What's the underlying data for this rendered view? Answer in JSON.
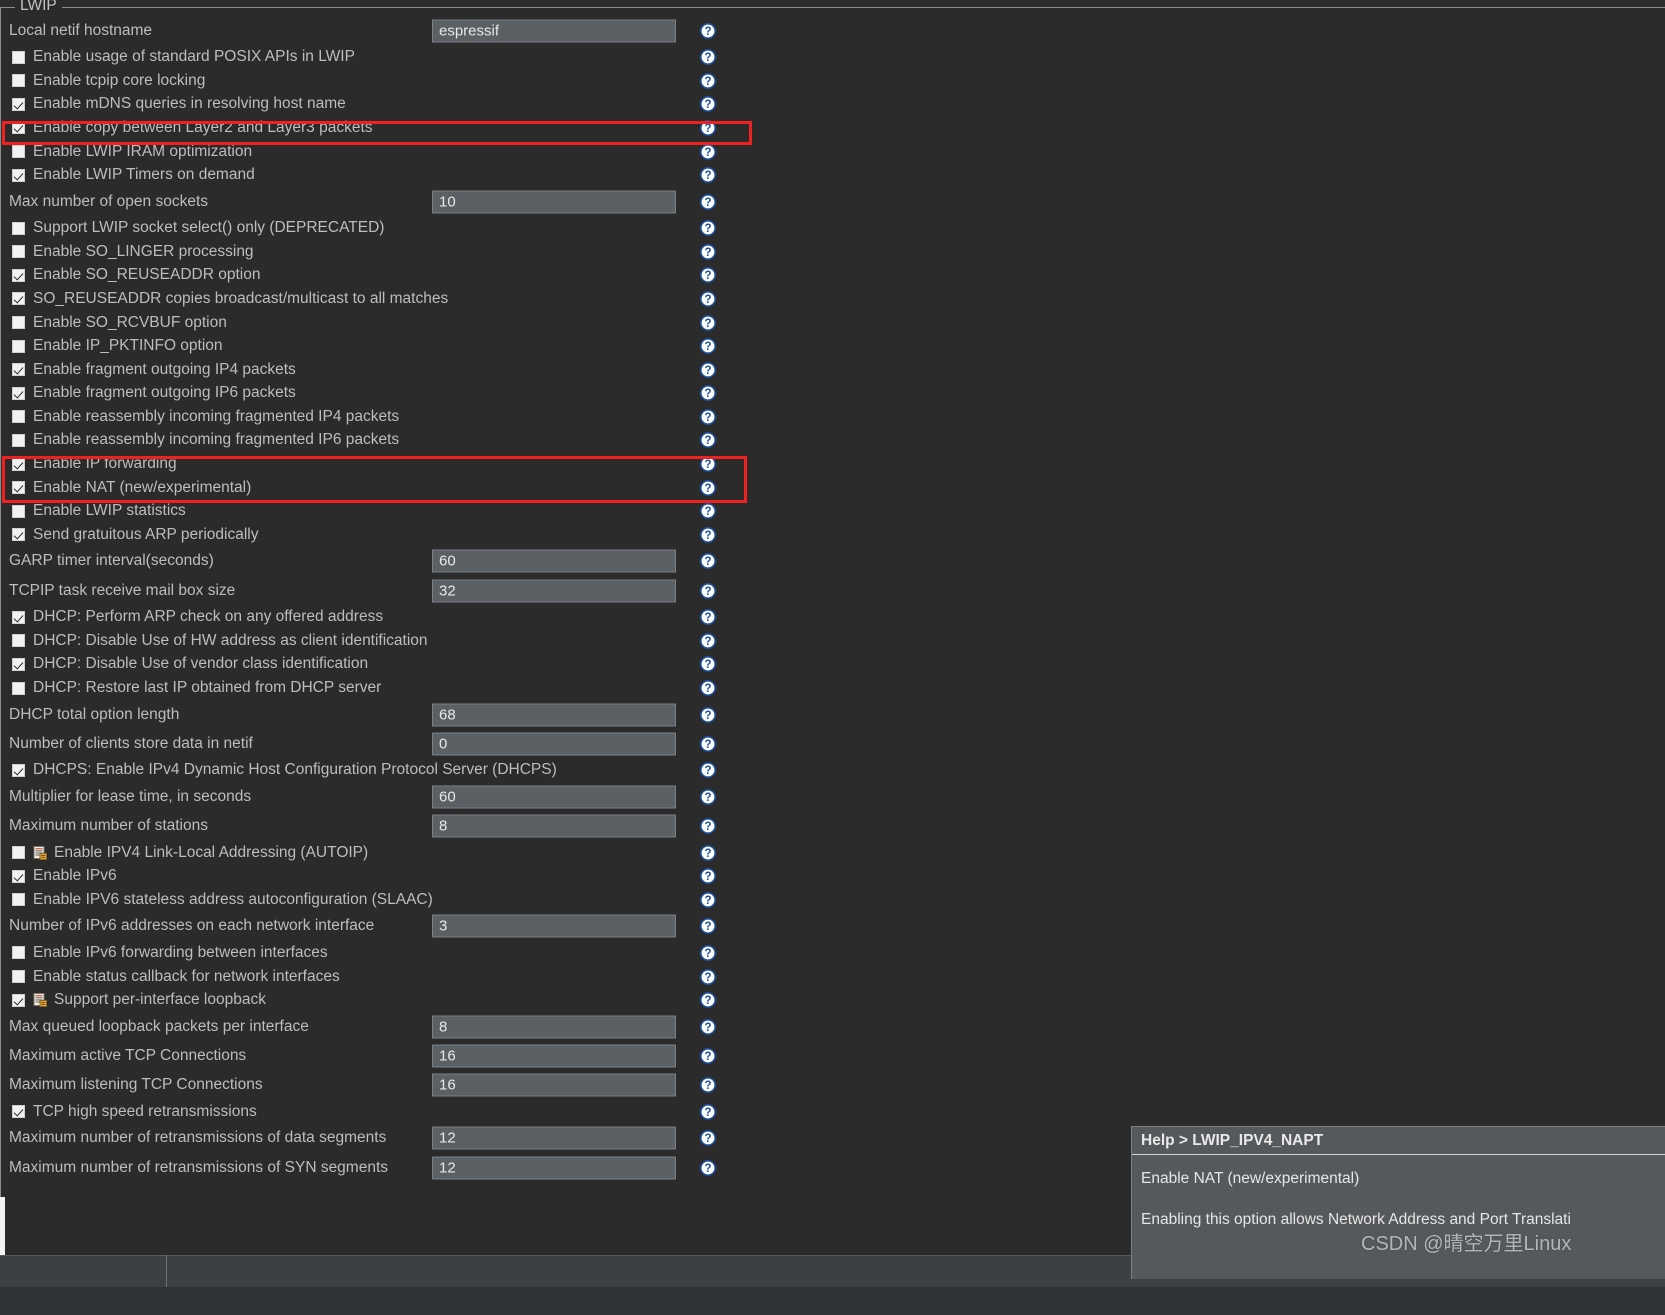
{
  "group": {
    "legend": "LWIP"
  },
  "colors": {
    "background": "#2b2b2b",
    "text": "#bdbdbd",
    "field_bg": "#5a6063",
    "field_border": "#7b8184",
    "highlight": "#f02020",
    "help_popup_bg": "#55595c",
    "checkbox_fill": "#f2f2f2"
  },
  "icons": {
    "help": "question-mark-circle-icon",
    "config_file": "config-file-icon",
    "taskbar_window": "window-icon"
  },
  "rows": [
    {
      "type": "text",
      "label": "Local netif hostname",
      "value": "espressif"
    },
    {
      "type": "check",
      "label": "Enable usage of standard POSIX APIs in LWIP",
      "checked": false
    },
    {
      "type": "check",
      "label": "Enable tcpip core locking",
      "checked": false
    },
    {
      "type": "check",
      "label": "Enable mDNS queries in resolving host name",
      "checked": true
    },
    {
      "type": "check",
      "label": "Enable copy between Layer2 and Layer3 packets",
      "checked": true
    },
    {
      "type": "check",
      "label": "Enable LWIP IRAM optimization",
      "checked": false
    },
    {
      "type": "check",
      "label": "Enable LWIP Timers on demand",
      "checked": true
    },
    {
      "type": "text",
      "label": "Max number of open sockets",
      "value": "10"
    },
    {
      "type": "check",
      "label": "Support LWIP socket select() only (DEPRECATED)",
      "checked": false
    },
    {
      "type": "check",
      "label": "Enable SO_LINGER processing",
      "checked": false
    },
    {
      "type": "check",
      "label": "Enable SO_REUSEADDR option",
      "checked": true
    },
    {
      "type": "check",
      "label": "SO_REUSEADDR copies broadcast/multicast to all matches",
      "checked": true
    },
    {
      "type": "check",
      "label": "Enable SO_RCVBUF option",
      "checked": false
    },
    {
      "type": "check",
      "label": "Enable IP_PKTINFO option",
      "checked": false
    },
    {
      "type": "check",
      "label": "Enable fragment outgoing IP4 packets",
      "checked": true
    },
    {
      "type": "check",
      "label": "Enable fragment outgoing IP6 packets",
      "checked": true
    },
    {
      "type": "check",
      "label": "Enable reassembly incoming fragmented IP4 packets",
      "checked": false
    },
    {
      "type": "check",
      "label": "Enable reassembly incoming fragmented IP6 packets",
      "checked": false
    },
    {
      "type": "check",
      "label": "Enable IP forwarding",
      "checked": true
    },
    {
      "type": "check",
      "label": "Enable NAT (new/experimental)",
      "checked": true
    },
    {
      "type": "check",
      "label": "Enable LWIP statistics",
      "checked": false
    },
    {
      "type": "check",
      "label": "Send gratuitous ARP periodically",
      "checked": true
    },
    {
      "type": "text",
      "label": "GARP timer interval(seconds)",
      "value": "60"
    },
    {
      "type": "text",
      "label": "TCPIP task receive mail box size",
      "value": "32"
    },
    {
      "type": "check",
      "label": "DHCP: Perform ARP check on any offered address",
      "checked": true
    },
    {
      "type": "check",
      "label": "DHCP: Disable Use of HW address as client identification",
      "checked": false
    },
    {
      "type": "check",
      "label": "DHCP: Disable Use of vendor class identification",
      "checked": true
    },
    {
      "type": "check",
      "label": "DHCP: Restore last IP obtained from DHCP server",
      "checked": false
    },
    {
      "type": "text",
      "label": "DHCP total option length",
      "value": "68"
    },
    {
      "type": "text",
      "label": "Number of clients store data in netif",
      "value": "0"
    },
    {
      "type": "check",
      "label": "DHCPS: Enable IPv4 Dynamic Host Configuration Protocol Server (DHCPS)",
      "checked": true
    },
    {
      "type": "text",
      "label": "Multiplier for lease time, in seconds",
      "value": "60"
    },
    {
      "type": "text",
      "label": "Maximum number of stations",
      "value": "8"
    },
    {
      "type": "check",
      "label": "Enable IPV4 Link-Local Addressing (AUTOIP)",
      "checked": false,
      "icon": true
    },
    {
      "type": "check",
      "label": "Enable IPv6",
      "checked": true
    },
    {
      "type": "check",
      "label": "Enable IPV6 stateless address autoconfiguration (SLAAC)",
      "checked": false
    },
    {
      "type": "text",
      "label": "Number of IPv6 addresses on each network interface",
      "value": "3"
    },
    {
      "type": "check",
      "label": "Enable IPv6 forwarding between interfaces",
      "checked": false
    },
    {
      "type": "check",
      "label": "Enable status callback for network interfaces",
      "checked": false
    },
    {
      "type": "check",
      "label": "Support per-interface loopback",
      "checked": true,
      "icon": true
    },
    {
      "type": "text",
      "label": "Max queued loopback packets per interface",
      "value": "8"
    },
    {
      "type": "text",
      "label": "Maximum active TCP Connections",
      "value": "16"
    },
    {
      "type": "text",
      "label": "Maximum listening TCP Connections",
      "value": "16"
    },
    {
      "type": "check",
      "label": "TCP high speed retransmissions",
      "checked": true
    },
    {
      "type": "text",
      "label": "Maximum number of retransmissions of data segments",
      "value": "12"
    },
    {
      "type": "text",
      "label": "Maximum number of retransmissions of SYN segments",
      "value": "12"
    }
  ],
  "help_popup": {
    "header": "Help > LWIP_IPV4_NAPT",
    "title": "Enable NAT (new/experimental)",
    "body": "Enabling this option allows Network Address and Port Translati"
  },
  "watermark": {
    "text": "CSDN @晴空万里Linux"
  }
}
